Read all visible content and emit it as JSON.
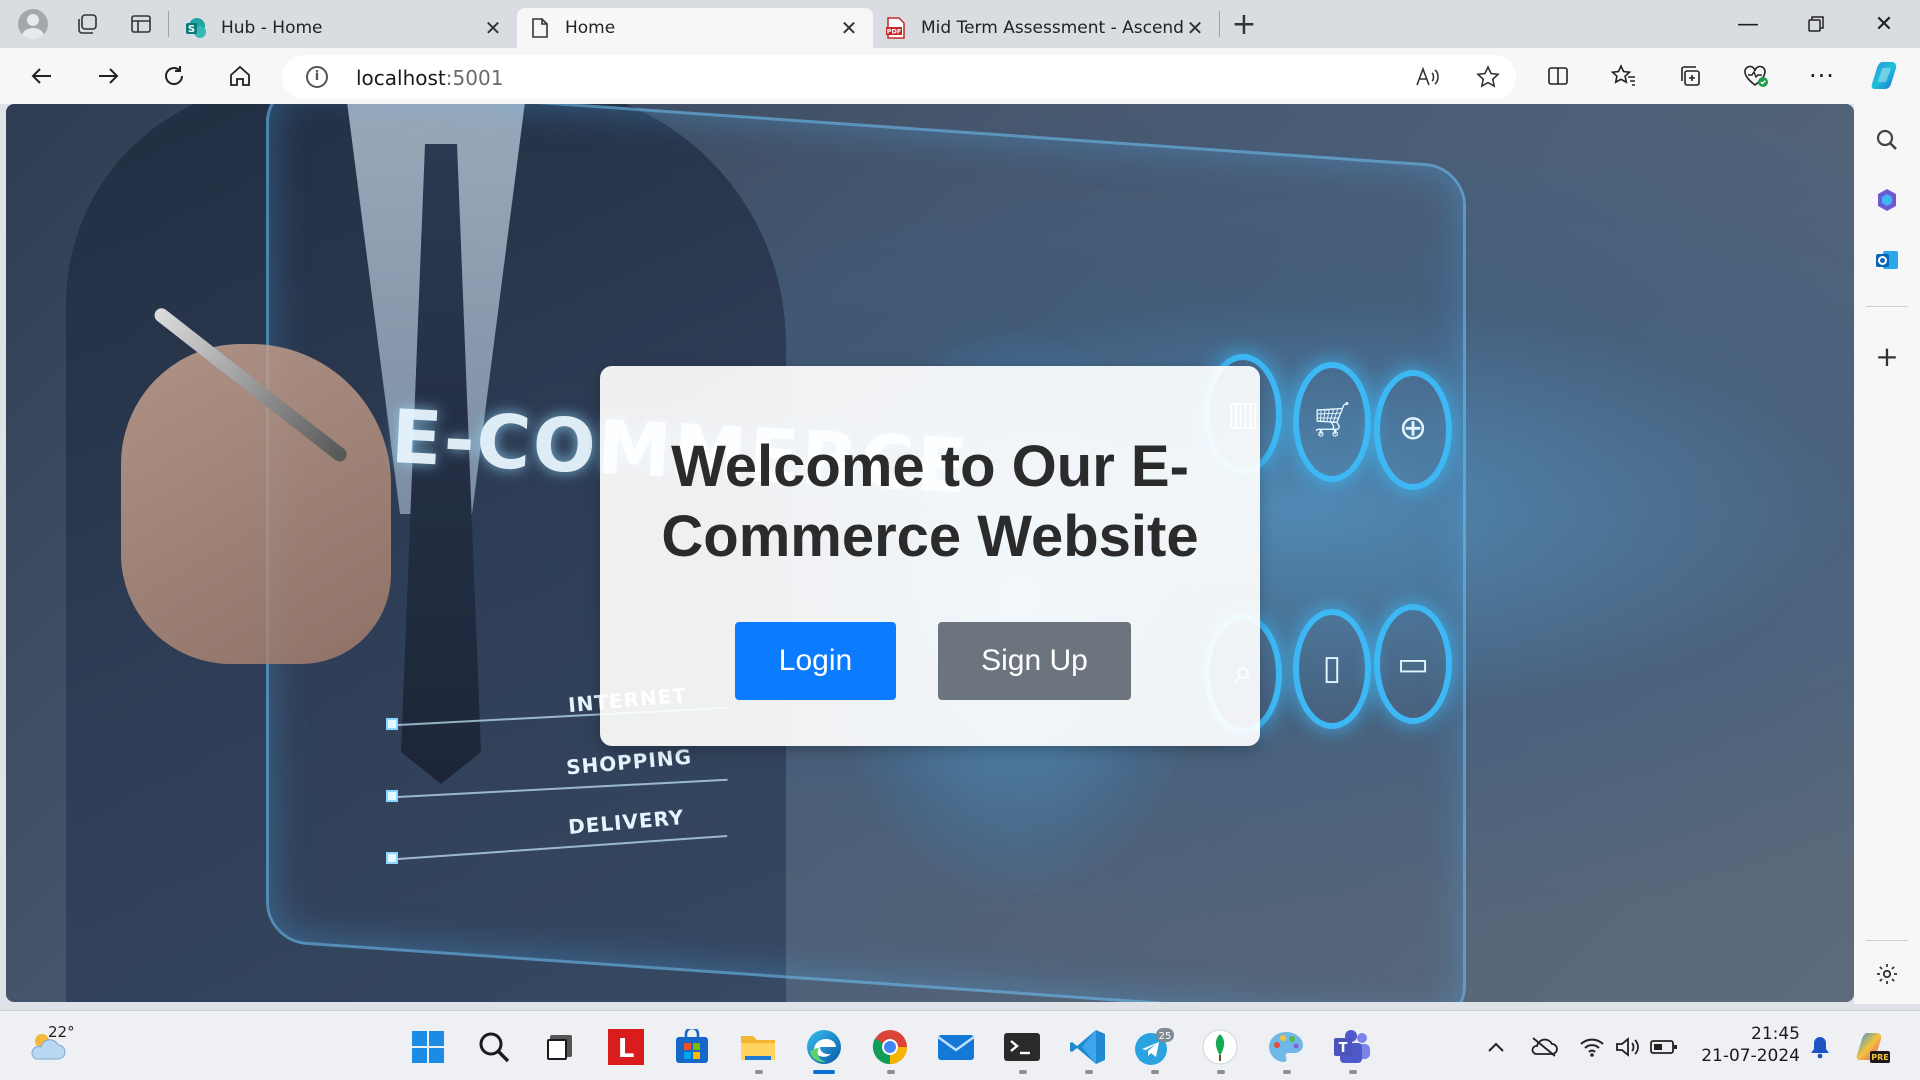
{
  "browser": {
    "tabs": [
      {
        "title": "Hub - Home",
        "active": false
      },
      {
        "title": "Home",
        "active": true
      },
      {
        "title": "Mid Term Assessment - Ascendio",
        "active": false
      }
    ],
    "address": {
      "host": "localhost",
      "port": ":5001"
    }
  },
  "page": {
    "heading": "Welcome to Our E-Commerce Website",
    "login_label": "Login",
    "signup_label": "Sign Up",
    "hero_image_text": {
      "main": "E-COMMERCE",
      "list": [
        "INTERNET",
        "SHOPPING",
        "DELIVERY"
      ]
    }
  },
  "taskbar": {
    "weather_temp": "22°",
    "clock_time": "21:45",
    "clock_date": "21-07-2024",
    "telegram_badge": "25"
  },
  "colors": {
    "login_button": "#0b7bff",
    "signup_button": "#6c757d",
    "edge_accent": "#0b6cd6"
  }
}
